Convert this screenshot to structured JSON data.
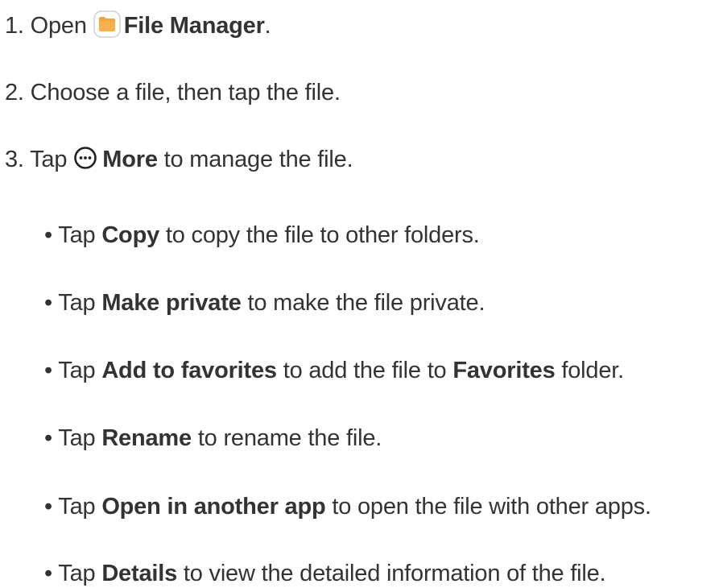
{
  "steps": [
    {
      "num": "1. Open",
      "bold": "File Manager",
      "rest": ".",
      "icon": "file-manager-folder-icon",
      "icon_color": "#F5A33A"
    },
    {
      "text": "2. Choose a file, then tap the file."
    },
    {
      "num": "3. Tap",
      "bold": "More",
      "rest": "to manage the file.",
      "icon": "more-options-icon"
    }
  ],
  "bullets": [
    {
      "prefix": "• Tap",
      "bold": "Copy",
      "rest": "to copy the file to other folders."
    },
    {
      "prefix": "• Tap",
      "bold": "Make private",
      "rest": "to make the file private."
    },
    {
      "prefix": "• Tap",
      "bold": "Add to favorites",
      "mid": "to add the file to",
      "bold2": "Favorites",
      "rest": "folder."
    },
    {
      "prefix": "• Tap",
      "bold": "Rename",
      "rest": "to rename the file."
    },
    {
      "prefix": "• Tap",
      "bold": "Open in another app",
      "rest": "to open the file with other apps."
    },
    {
      "prefix": "• Tap",
      "bold": "Details",
      "rest": "to view the detailed information of the file."
    }
  ]
}
